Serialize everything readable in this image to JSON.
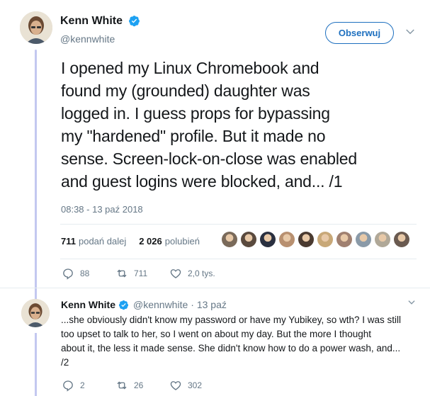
{
  "tweet": {
    "author_name": "Kenn White",
    "author_handle": "@kennwhite",
    "follow_label": "Obserwuj",
    "text": "I opened my Linux Chromebook and\nfound my (grounded) daughter was\nlogged in. I guess props for bypassing\nmy \"hardened\" profile. But it made no\nsense. Screen-lock-on-close was enabled\nand guest logins were blocked, and... /1",
    "timestamp": "08:38 - 13 paź 2018",
    "retweets_count": "711",
    "retweets_label": "podań dalej",
    "likes_count": "2 026",
    "likes_label": "polubień",
    "liker_avatars": [
      "#7a6a5a",
      "#5a4a3e",
      "#2a3040",
      "#b89070",
      "#4a3a30",
      "#c8a878",
      "#a08070",
      "#8a9aa8",
      "#b0a898",
      "#6a5a50"
    ],
    "actions": {
      "replies": "88",
      "retweets": "711",
      "likes": "2,0 tys."
    }
  },
  "reply": {
    "author_name": "Kenn White",
    "author_handle": "@kennwhite",
    "date": "· 13 paź",
    "text": "...she obviously didn't know my password or have my Yubikey, so wth? I was still\ntoo upset to talk to her, so I went on about my day. But the more I thought\nabout it, the less it made sense. She didn't know how to do a power wash, and...\n/2",
    "actions": {
      "replies": "2",
      "retweets": "26",
      "likes": "302"
    }
  },
  "colors": {
    "accent": "#1da1f2",
    "follow_border": "#1d6fbf",
    "thread_line": "#c3c8f0",
    "muted": "#657786"
  }
}
